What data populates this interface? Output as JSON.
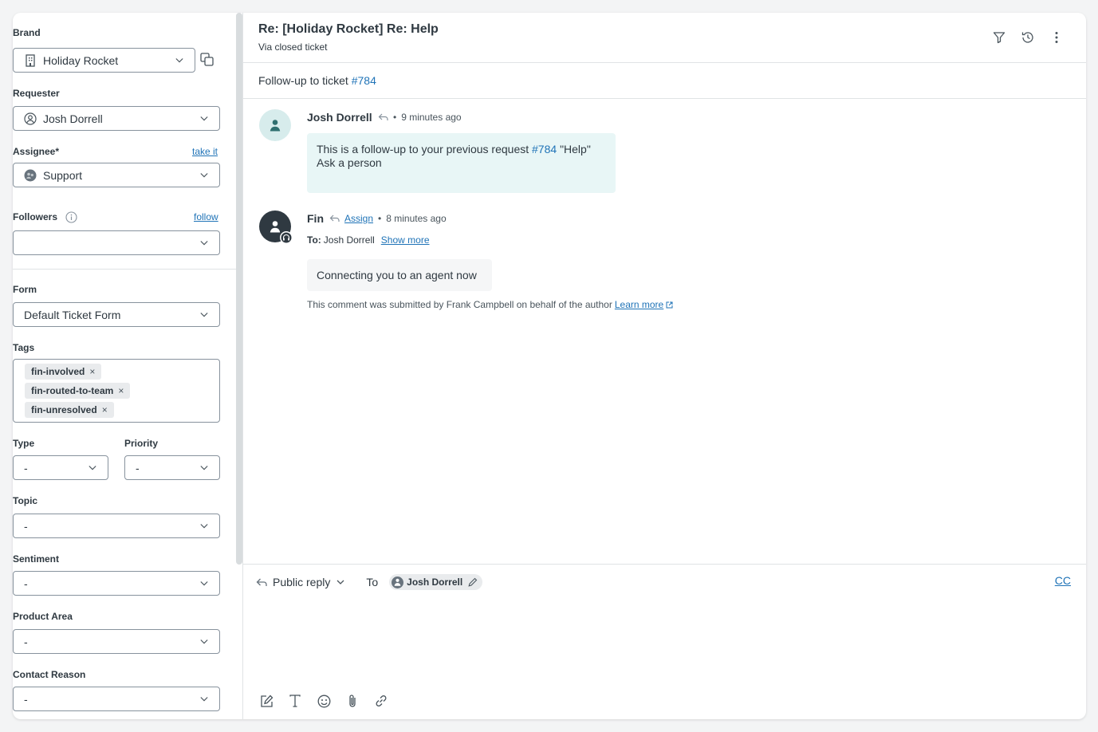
{
  "sidebar": {
    "brand": {
      "label": "Brand",
      "value": "Holiday Rocket"
    },
    "requester": {
      "label": "Requester",
      "value": "Josh Dorrell"
    },
    "assignee": {
      "label": "Assignee*",
      "link": "take it",
      "value": "Support"
    },
    "followers": {
      "label": "Followers",
      "link": "follow",
      "value": ""
    },
    "form": {
      "label": "Form",
      "value": "Default Ticket Form"
    },
    "tags": {
      "label": "Tags",
      "items": [
        "fin-involved",
        "fin-routed-to-team",
        "fin-unresolved"
      ],
      "remove_glyph": "×"
    },
    "type": {
      "label": "Type",
      "value": "-"
    },
    "priority": {
      "label": "Priority",
      "value": "-"
    },
    "topic": {
      "label": "Topic",
      "value": "-"
    },
    "sentiment": {
      "label": "Sentiment",
      "value": "-"
    },
    "product_area": {
      "label": "Product Area",
      "value": "-"
    },
    "contact_reason": {
      "label": "Contact Reason",
      "value": "-"
    }
  },
  "ticket": {
    "title": "Re: [Holiday Rocket] Re: Help",
    "subtitle": "Via closed ticket",
    "followup_prefix": "Follow-up to ticket",
    "followup_ticket": "#784"
  },
  "conversation": [
    {
      "author": "Josh Dorrell",
      "time": "9 minutes ago",
      "dot": "•",
      "body_prefix": "This is a follow-up to your previous request",
      "body_link": "#784",
      "body_suffix": "\"Help\"",
      "body_line2": "Ask a person"
    },
    {
      "author": "Fin",
      "assign_link": "Assign",
      "time": "8 minutes ago",
      "dot": "•",
      "to_label": "To:",
      "to_value": "Josh Dorrell",
      "show_more": "Show more",
      "body": "Connecting you to an agent now",
      "note": "This comment was submitted by Frank Campbell on behalf of the author",
      "note_link": "Learn more"
    }
  ],
  "reply": {
    "mode": "Public reply",
    "to_label": "To",
    "recipient": "Josh Dorrell",
    "cc": "CC"
  },
  "colors": {
    "link": "#1f73b7",
    "bubble_customer": "#e8f6f6",
    "bubble_agent": "#f5f6f7",
    "avatar_customer": "#d7ecec",
    "avatar_bot": "#2f3941"
  }
}
